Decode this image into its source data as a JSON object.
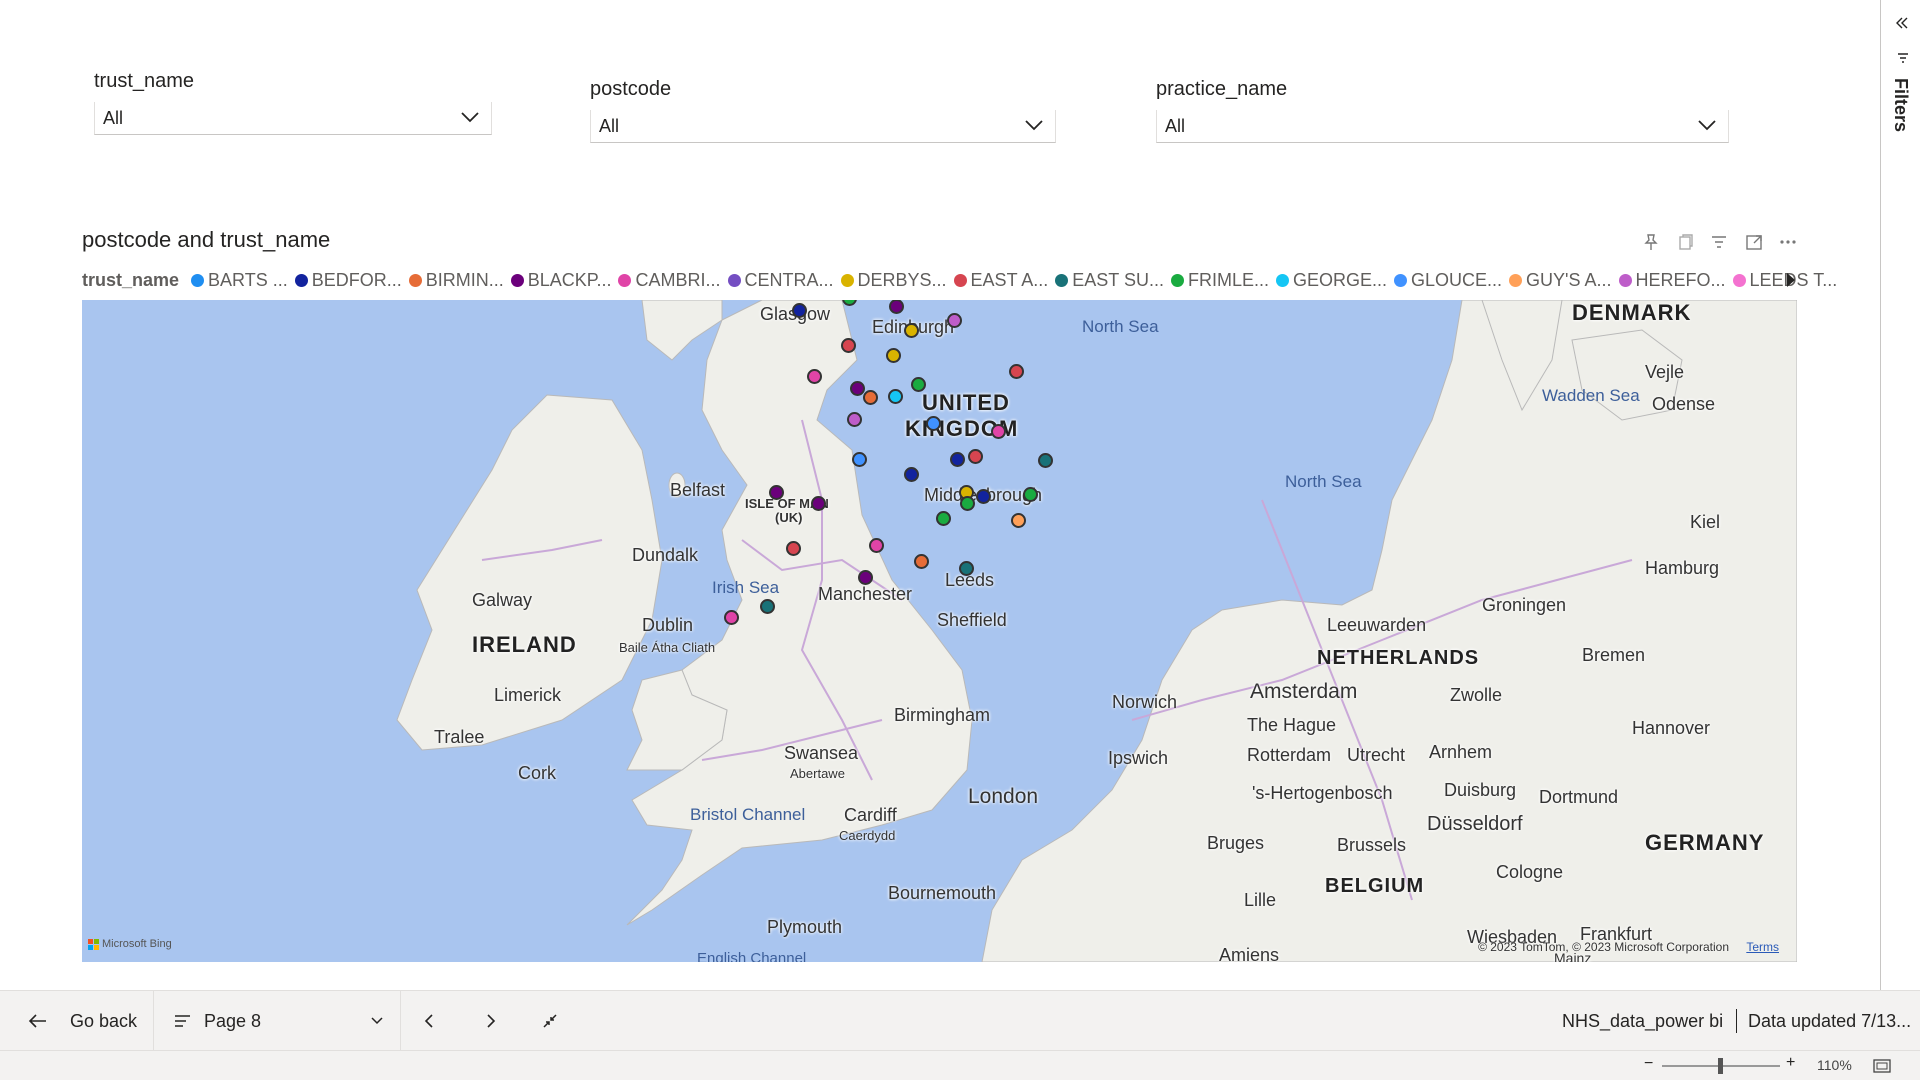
{
  "slicers": [
    {
      "title": "trust_name",
      "value": "All"
    },
    {
      "title": "postcode",
      "value": "All"
    },
    {
      "title": "practice_name",
      "value": "All"
    }
  ],
  "visual": {
    "title": "postcode and trust_name",
    "legend_title": "trust_name",
    "legend": [
      {
        "label": "BARTS ...",
        "color": "#1f8ef1"
      },
      {
        "label": "BEDFOR...",
        "color": "#12239e"
      },
      {
        "label": "BIRMIN...",
        "color": "#e66c37"
      },
      {
        "label": "BLACKP...",
        "color": "#6b007b"
      },
      {
        "label": "CAMBRI...",
        "color": "#e044a7"
      },
      {
        "label": "CENTRA...",
        "color": "#744ec2"
      },
      {
        "label": "DERBYS...",
        "color": "#d9b300"
      },
      {
        "label": "EAST A...",
        "color": "#d64550"
      },
      {
        "label": "EAST SU...",
        "color": "#197278"
      },
      {
        "label": "FRIMLE...",
        "color": "#1aab40"
      },
      {
        "label": "GEORGE...",
        "color": "#15c6f4"
      },
      {
        "label": "GLOUCE...",
        "color": "#4092ff"
      },
      {
        "label": "GUY'S A...",
        "color": "#ffa058"
      },
      {
        "label": "HEREFO...",
        "color": "#be5dc9"
      },
      {
        "label": "LEEDS T...",
        "color": "#f472d0"
      }
    ]
  },
  "map": {
    "countries": [
      "UNITED",
      "KINGDOM",
      "IRELAND",
      "NETHERLANDS",
      "BELGIUM",
      "GERMANY",
      "DENMARK",
      "ISLE OF MAN",
      "(UK)"
    ],
    "seas": [
      "North Sea",
      "North Sea",
      "Irish Sea",
      "Bristol Channel",
      "Wadden Sea",
      "English Channel"
    ],
    "cities": [
      "Glasgow",
      "Edinburgh",
      "Belfast",
      "Middlesbrough",
      "Dundalk",
      "Leeds",
      "Manchester",
      "Sheffield",
      "Galway",
      "Dublin",
      "Baile Átha Cliath",
      "Limerick",
      "Tralee",
      "Cork",
      "Birmingham",
      "Norwich",
      "Ipswich",
      "Swansea",
      "Abertawe",
      "Cardiff",
      "Caerdydd",
      "London",
      "Bournemouth",
      "Plymouth",
      "Vejle",
      "Odense",
      "Kiel",
      "Hamburg",
      "Groningen",
      "Leeuwarden",
      "Amsterdam",
      "Bremen",
      "Zwolle",
      "The Hague",
      "Rotterdam",
      "Utrecht",
      "Arnhem",
      "Hannover",
      "'s-Hertogenbosch",
      "Duisburg",
      "Dortmund",
      "Düsseldorf",
      "Bruges",
      "Brussels",
      "Cologne",
      "Lille",
      "Wiesbaden",
      "Frankfurt",
      "Amiens",
      "Mainz"
    ],
    "attribution": "© 2023 TomTom, © 2023 Microsoft Corporation",
    "terms": "Terms",
    "bing": "Microsoft Bing"
  },
  "filters_label": "Filters",
  "bottom": {
    "go_back": "Go back",
    "page": "Page 8",
    "report_name": "NHS_data_power bi",
    "data_updated": "Data updated 7/13...",
    "zoom": "110%"
  }
}
